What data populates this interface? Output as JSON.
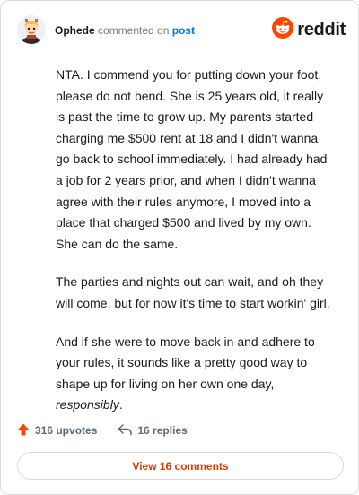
{
  "header": {
    "username": "Ophede",
    "verb": "commented on",
    "link": "post",
    "brand": "reddit",
    "avatar_icon": "snoo-avatar-icon",
    "brand_icon": "reddit-logo-icon"
  },
  "comment": {
    "paragraphs": [
      "NTA. I commend you for putting down your foot, please do not bend. She is 25 years old, it really is past the time to grow up. My parents started charging me $500 rent at 18 and I didn't wanna go back to school immediately. I had already had a job for 2 years prior, and when I didn't wanna agree with their rules anymore, I moved into a place that charged $500 and lived by my own. She can do the same.",
      "The parties and nights out can wait, and oh they will come, but for now it's time to start workin' girl."
    ],
    "last_paragraph_prefix": "And if she were to move back in and adhere to your rules, it sounds like a pretty good way to shape up for living on her own one day,",
    "last_paragraph_emphasis": "responsibly",
    "last_paragraph_suffix": "."
  },
  "footer": {
    "upvotes": "316 upvotes",
    "replies": "16 replies",
    "view_comments": "View 16 comments",
    "upvote_icon": "upvote-arrow-icon",
    "reply_icon": "reply-arrow-icon"
  },
  "colors": {
    "brand_orange": "#ff4500",
    "link_blue": "#0079d3",
    "view_button_text": "#d93a00",
    "muted": "#576f76"
  }
}
